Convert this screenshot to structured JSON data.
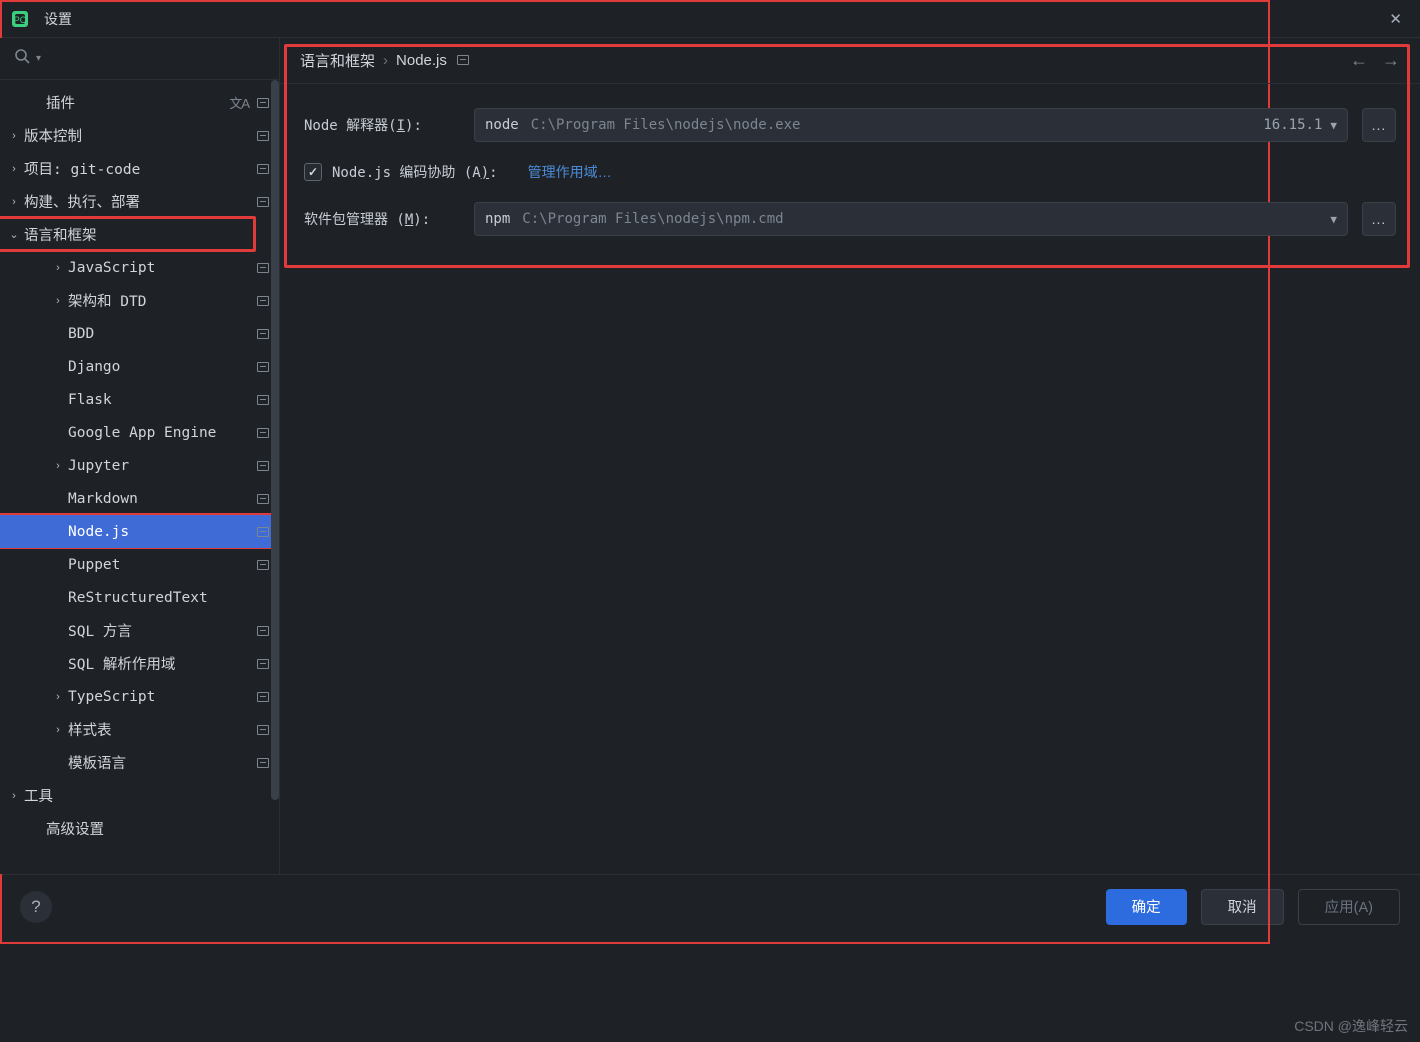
{
  "window": {
    "title": "设置"
  },
  "sidebar": {
    "items": [
      {
        "label": "插件",
        "level": 1,
        "chev": "",
        "trail": [
          "lang",
          "box"
        ]
      },
      {
        "label": "版本控制",
        "level": 0,
        "chev": ">",
        "trail": [
          "box"
        ]
      },
      {
        "label": "项目: git-code",
        "level": 0,
        "chev": ">",
        "trail": [
          "box"
        ]
      },
      {
        "label": "构建、执行、部署",
        "level": 0,
        "chev": ">",
        "trail": [
          "box"
        ]
      },
      {
        "label": "语言和框架",
        "level": 0,
        "chev": "v",
        "trail": [],
        "box_lang": true
      },
      {
        "label": "JavaScript",
        "level": 2,
        "chev": ">",
        "trail": [
          "box"
        ]
      },
      {
        "label": "架构和 DTD",
        "level": 2,
        "chev": ">",
        "trail": [
          "box"
        ]
      },
      {
        "label": "BDD",
        "level": 2,
        "chev": "",
        "trail": [
          "box"
        ]
      },
      {
        "label": "Django",
        "level": 2,
        "chev": "",
        "trail": [
          "box"
        ]
      },
      {
        "label": "Flask",
        "level": 2,
        "chev": "",
        "trail": [
          "box"
        ]
      },
      {
        "label": "Google App Engine",
        "level": 2,
        "chev": "",
        "trail": [
          "box"
        ]
      },
      {
        "label": "Jupyter",
        "level": 2,
        "chev": ">",
        "trail": [
          "box"
        ]
      },
      {
        "label": "Markdown",
        "level": 2,
        "chev": "",
        "trail": [
          "box"
        ]
      },
      {
        "label": "Node.js",
        "level": 2,
        "chev": "",
        "trail": [
          "box"
        ],
        "selected": true,
        "box_sel": true
      },
      {
        "label": "Puppet",
        "level": 2,
        "chev": "",
        "trail": [
          "box"
        ]
      },
      {
        "label": "ReStructuredText",
        "level": 2,
        "chev": "",
        "trail": []
      },
      {
        "label": "SQL 方言",
        "level": 2,
        "chev": "",
        "trail": [
          "box"
        ]
      },
      {
        "label": "SQL 解析作用域",
        "level": 2,
        "chev": "",
        "trail": [
          "box"
        ]
      },
      {
        "label": "TypeScript",
        "level": 2,
        "chev": ">",
        "trail": [
          "box"
        ]
      },
      {
        "label": "样式表",
        "level": 2,
        "chev": ">",
        "trail": [
          "box"
        ]
      },
      {
        "label": "模板语言",
        "level": 2,
        "chev": "",
        "trail": [
          "box"
        ]
      },
      {
        "label": "工具",
        "level": 0,
        "chev": ">",
        "trail": []
      },
      {
        "label": "高级设置",
        "level": 1,
        "chev": "",
        "trail": []
      }
    ]
  },
  "breadcrumb": {
    "root": "语言和框架",
    "leaf": "Node.js"
  },
  "form": {
    "interpreter_label": "Node 解释器(I):",
    "interpreter_kind": "node",
    "interpreter_path": "C:\\Program Files\\nodejs\\node.exe",
    "interpreter_version": "16.15.1",
    "coding_assist_label": "Node.js 编码协助 (A):",
    "coding_assist_checked": true,
    "manage_scope_link": "管理作用域…",
    "pkg_manager_label": "软件包管理器 (M):",
    "pkg_manager_kind": "npm",
    "pkg_manager_path": "C:\\Program Files\\nodejs\\npm.cmd",
    "more_btn": "..."
  },
  "footer": {
    "ok": "确定",
    "cancel": "取消",
    "apply": "应用(A)"
  },
  "watermark": "CSDN @逸峰轻云"
}
